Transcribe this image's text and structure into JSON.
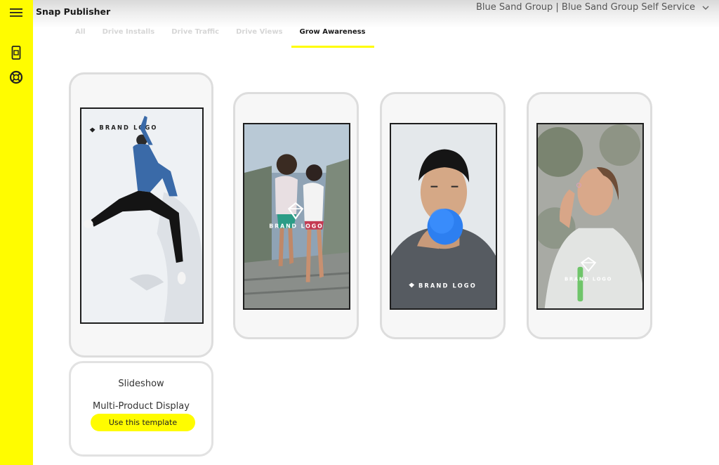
{
  "app": {
    "title": "Snap Publisher"
  },
  "account": {
    "label": "Blue Sand Group | Blue Sand Group Self Service"
  },
  "sidebar": {
    "menu_icon": "hamburger-menu-icon",
    "items": [
      {
        "icon": "mobile-preview-icon"
      },
      {
        "icon": "help-lifebuoy-icon"
      }
    ]
  },
  "tabs": [
    {
      "label": "All",
      "active": false
    },
    {
      "label": "Drive Installs",
      "active": false
    },
    {
      "label": "Drive Traffic",
      "active": false
    },
    {
      "label": "Drive Views",
      "active": false
    },
    {
      "label": "Grow Awareness",
      "active": true
    }
  ],
  "templates": [
    {
      "brand_logo": "BRAND LOGO",
      "selected": true
    },
    {
      "brand_logo": "BRAND LOGO",
      "selected": false
    },
    {
      "brand_logo": "BRAND LOGO",
      "selected": false
    },
    {
      "brand_logo": "BRAND LOGO",
      "selected": false
    }
  ],
  "selected_template": {
    "title": "Slideshow",
    "subtitle": "Multi-Product Display",
    "button_label": "Use this template"
  },
  "colors": {
    "accent": "#fffc00",
    "text": "#1b1b1b"
  }
}
